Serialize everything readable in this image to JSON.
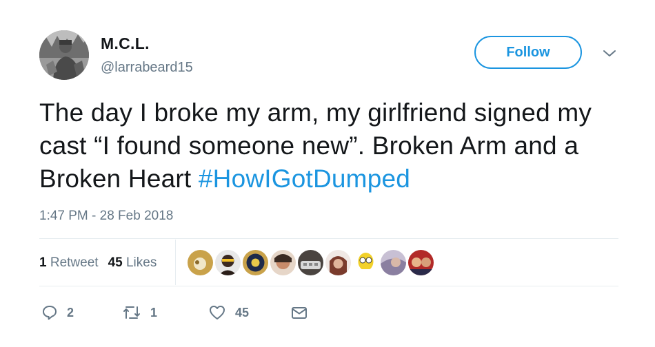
{
  "user": {
    "name": "M.C.L.",
    "handle": "@larrabeard15",
    "avatar_icon": "profile-photo"
  },
  "header": {
    "follow_label": "Follow",
    "caret_icon": "chevron-down-icon"
  },
  "tweet": {
    "text_line": "The day I broke my arm, my girlfriend signed my cast “I found someone new”. Broken Arm and a Broken Heart ",
    "hashtag": "#HowIGotDumped",
    "timestamp": "1:47 PM - 28 Feb 2018"
  },
  "stats": {
    "retweets_count": "1",
    "retweets_label": "Retweet",
    "likes_count": "45",
    "likes_label": "Likes"
  },
  "likers": [
    {
      "icon": "liker-avatar",
      "color": "#c9a24a"
    },
    {
      "icon": "liker-avatar",
      "color": "#3b2a22"
    },
    {
      "icon": "liker-avatar",
      "color": "#1e2a4a"
    },
    {
      "icon": "liker-avatar",
      "color": "#c88b6a"
    },
    {
      "icon": "liker-avatar",
      "color": "#4a4440"
    },
    {
      "icon": "liker-avatar",
      "color": "#7a3b2c"
    },
    {
      "icon": "liker-avatar",
      "color": "#f2d12a"
    },
    {
      "icon": "liker-avatar",
      "color": "#8a7fa0"
    },
    {
      "icon": "liker-avatar",
      "color": "#b22a28"
    }
  ],
  "actions": {
    "reply_count": "2",
    "retweet_count": "1",
    "like_count": "45",
    "reply_icon": "reply-icon",
    "retweet_icon": "retweet-icon",
    "like_icon": "heart-icon",
    "dm_icon": "envelope-icon"
  },
  "colors": {
    "accent": "#1b95e0",
    "secondary_text": "#657786",
    "divider": "#e6ecf0"
  }
}
